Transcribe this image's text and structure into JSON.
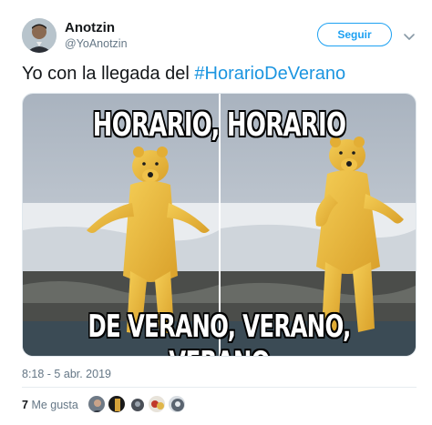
{
  "author": {
    "name": "Anotzin",
    "handle": "@YoAnotzin"
  },
  "actions": {
    "follow_label": "Seguir"
  },
  "tweet": {
    "text_prefix": "Yo con la llegada del ",
    "hashtag": "#HorarioDeVerano"
  },
  "media": {
    "caption_top": "HORARIO, HORARIO",
    "caption_bottom": "DE VERANO, VERANO, VERANO"
  },
  "meta": {
    "timestamp": "8:18 - 5 abr. 2019"
  },
  "engagement": {
    "like_count": "7",
    "like_label": "Me gusta",
    "liker_avatars": [
      "avatar-1",
      "avatar-2",
      "avatar-3",
      "avatar-4",
      "avatar-5"
    ]
  },
  "colors": {
    "accent": "#1da1f2",
    "hashtag": "#1b95e0",
    "secondary_text": "#657786",
    "bear_fur": "#e8b63a"
  }
}
